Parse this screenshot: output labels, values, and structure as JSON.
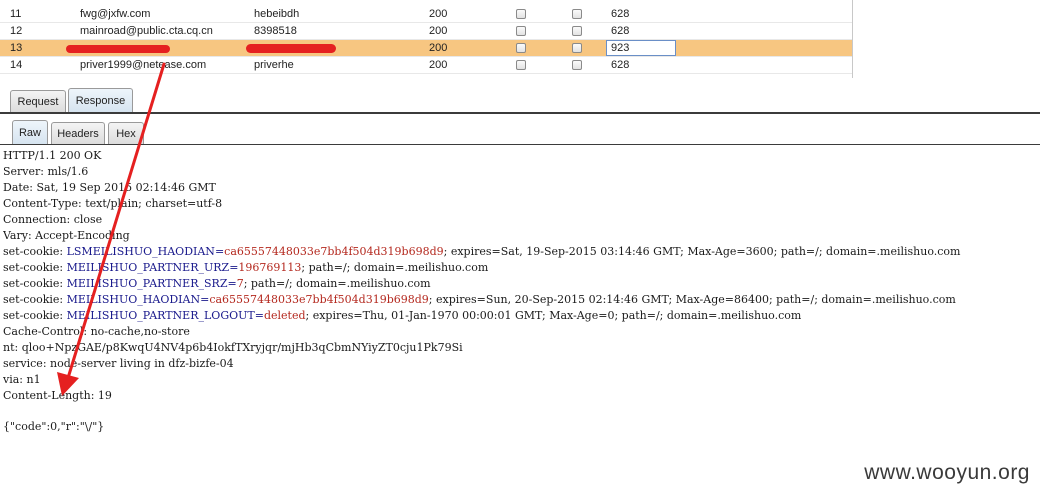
{
  "results": {
    "rows": [
      {
        "id": "11",
        "username": "fwg@jxfw.com",
        "password": "hebeibdh",
        "status": "200",
        "length": "628",
        "selected": false
      },
      {
        "id": "12",
        "username": "mainroad@public.cta.cq.cn",
        "password": "8398518",
        "status": "200",
        "length": "628",
        "selected": false
      },
      {
        "id": "13",
        "username": "",
        "password": "",
        "status": "200",
        "length": "923",
        "selected": true
      },
      {
        "id": "14",
        "username": "priver1999@netease.com",
        "password": "priverhe",
        "status": "200",
        "length": "628",
        "selected": false
      }
    ]
  },
  "tabs": {
    "request": "Request",
    "response": "Response"
  },
  "subtabs": {
    "raw": "Raw",
    "headers": "Headers",
    "hex": "Hex"
  },
  "response": {
    "lines": [
      "HTTP/1.1 200 OK",
      "Server: mls/1.6",
      "Date: Sat, 19 Sep 2015 02:14:46 GMT",
      "Content-Type: text/plain; charset=utf-8",
      "Connection: close",
      "Vary: Accept-Encoding"
    ],
    "cookies": [
      {
        "prefix": "set-cookie: ",
        "name": "LSMEILISHUO_HAODIAN",
        "eq": "=",
        "value": "ca65557448033e7bb4f504d319b698d9",
        "rest": "; expires=Sat, 19-Sep-2015 03:14:46 GMT; Max-Age=3600; path=/; domain=.meilishuo.com"
      },
      {
        "prefix": "set-cookie: ",
        "name": "MEILISHUO_PARTNER_URZ",
        "eq": "=",
        "value": "196769113",
        "rest": "; path=/; domain=.meilishuo.com"
      },
      {
        "prefix": "set-cookie: ",
        "name": "MEILISHUO_PARTNER_SRZ",
        "eq": "=",
        "value": "7",
        "rest": "; path=/; domain=.meilishuo.com"
      },
      {
        "prefix": "set-cookie: ",
        "name": "MEILISHUO_HAODIAN",
        "eq": "=",
        "value": "ca65557448033e7bb4f504d319b698d9",
        "rest": "; expires=Sun, 20-Sep-2015 02:14:46 GMT; Max-Age=86400; path=/; domain=.meilishuo.com"
      },
      {
        "prefix": "set-cookie: ",
        "name": "MEILISHUO_PARTNER_LOGOUT",
        "eq": "=",
        "value": "deleted",
        "rest": "; expires=Thu, 01-Jan-1970 00:00:01 GMT; Max-Age=0; path=/; domain=.meilishuo.com"
      }
    ],
    "trailing": [
      "Cache-Control: no-cache,no-store",
      "nt: qloo+NpzGAE/p8KwqU4NV4p6b4IokfTXryjqr/mjHb3qCbmNYiyZT0cju1Pk79Si",
      "service: node-server living in dfz-bizfe-04",
      "via: n1",
      "Content-Length: 19"
    ],
    "body": "{\"code\":0,\"r\":\"\\/\"}"
  },
  "watermark": "www.wooyun.org",
  "colors": {
    "selected_row": "#f7c681",
    "arrow": "#e52020",
    "cookie_name": "#1a1a8c",
    "cookie_value": "#b4281e"
  }
}
